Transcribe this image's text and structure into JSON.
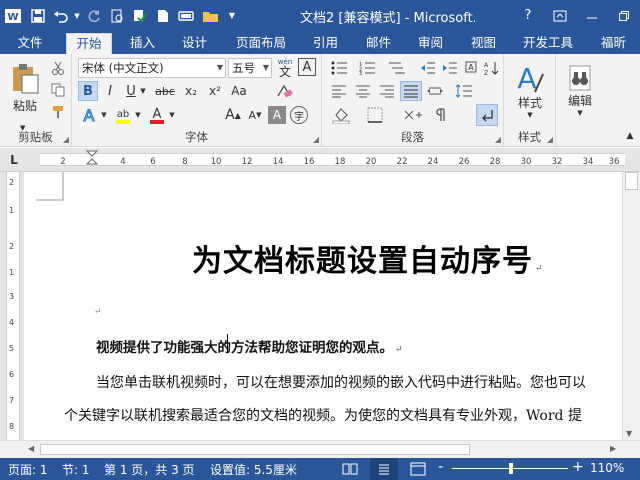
{
  "titlebar": {
    "title": "文档2 [兼容模式] - Microsoft...",
    "help": "?",
    "icons": [
      "word-icon",
      "save-icon",
      "undo-icon",
      "redo-icon",
      "print-preview-icon",
      "spellcheck-icon",
      "new-icon",
      "tablet-icon",
      "open-folder-icon",
      "customize-icon"
    ]
  },
  "tabs": [
    "文件",
    "开始",
    "插入",
    "设计",
    "页面布局",
    "引用",
    "邮件",
    "审阅",
    "视图",
    "开发工具",
    "福昕"
  ],
  "ribbon": {
    "clipboard": {
      "label": "剪贴板",
      "paste": "粘贴"
    },
    "font": {
      "label": "字体",
      "name": "宋体 (中文正文)",
      "size": "五号",
      "wen": "wén",
      "wen_char": "文",
      "bold": "B",
      "italic": "I",
      "underline": "U",
      "strike": "abc",
      "sub": "x₂",
      "sup": "x²",
      "aa": "Aa",
      "grow": "A",
      "shrink": "A",
      "clear": "A",
      "enclose": "字"
    },
    "paragraph": {
      "label": "段落"
    },
    "styles": {
      "label": "样式",
      "text": "样式"
    },
    "editing": {
      "text": "编辑"
    }
  },
  "ruler": {
    "ticks": [
      "2",
      "4",
      "6",
      "8",
      "10",
      "12",
      "14",
      "16",
      "18",
      "20",
      "22",
      "24",
      "26",
      "28",
      "30",
      "32",
      "34",
      "36",
      "38"
    ],
    "corner": "L"
  },
  "vruler": {
    "ticks": [
      "2",
      "1",
      "1",
      "2",
      "3",
      "4",
      "5",
      "6",
      "7",
      "8",
      "9",
      "10"
    ]
  },
  "document": {
    "title": "为文档标题设置自动序号",
    "para_heading": "视频提供了功能强大的方法帮助您证明您的观点。",
    "para1": "当您单击联机视频时，可以在想要添加的视频的嵌入代码中进行粘贴。您也可以",
    "para2": "个关键字以联机搜索最适合您的文档的视频。为使您的文档具有专业外观，Word 提",
    "mark": "↵"
  },
  "status": {
    "page": "页面: 1",
    "section": "节: 1",
    "pages": "第 1 页，共 3 页",
    "setting": "设置值: 5.5厘米",
    "minus": "-",
    "plus": "+",
    "zoom": "110%"
  },
  "colors": {
    "accent": "#2b579a",
    "ribbon": "#f3f3f3"
  }
}
